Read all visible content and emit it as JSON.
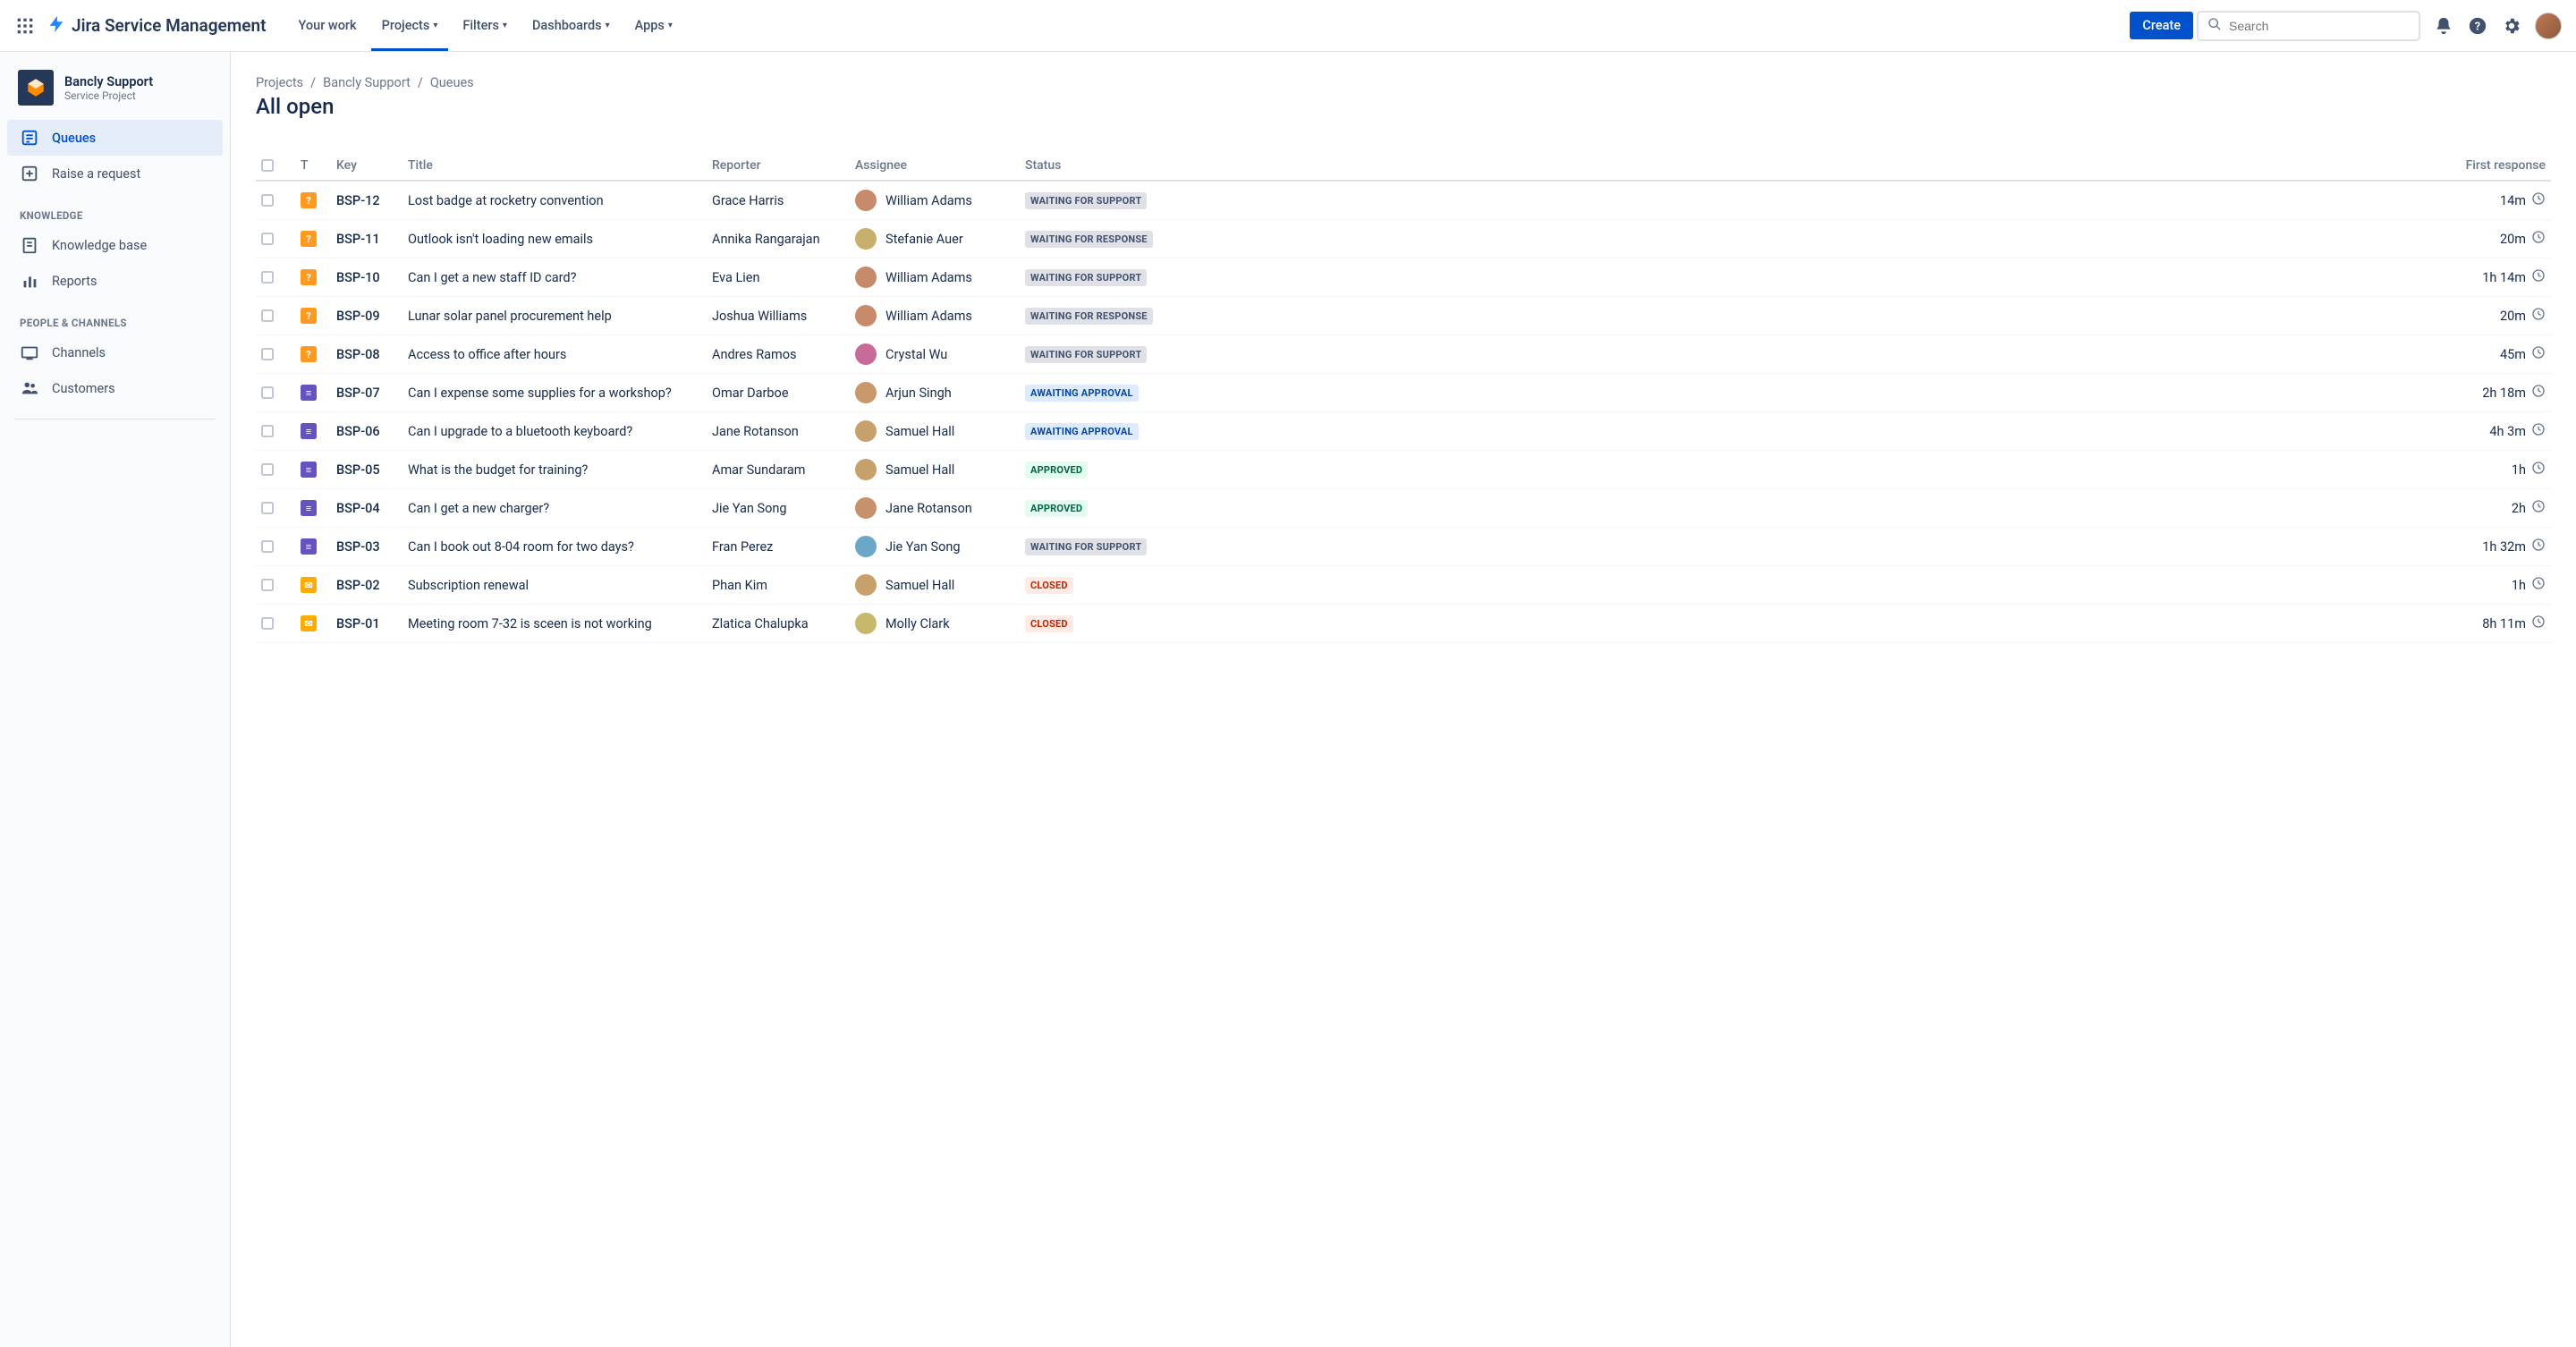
{
  "topnav": {
    "product": "Jira Service Management",
    "items": [
      "Your work",
      "Projects",
      "Filters",
      "Dashboards",
      "Apps"
    ],
    "activeIndex": 1,
    "create": "Create",
    "searchPlaceholder": "Search"
  },
  "sidebar": {
    "project": {
      "name": "Bancly Support",
      "type": "Service Project"
    },
    "primary": [
      {
        "label": "Queues",
        "icon": "queues"
      },
      {
        "label": "Raise a request",
        "icon": "raise"
      }
    ],
    "activePrimary": 0,
    "headings": {
      "knowledge": "KNOWLEDGE",
      "people": "PEOPLE & CHANNELS"
    },
    "knowledge": [
      {
        "label": "Knowledge base",
        "icon": "kb"
      },
      {
        "label": "Reports",
        "icon": "reports"
      }
    ],
    "people": [
      {
        "label": "Channels",
        "icon": "channels"
      },
      {
        "label": "Customers",
        "icon": "customers"
      }
    ]
  },
  "breadcrumb": [
    "Projects",
    "Bancly Support",
    "Queues"
  ],
  "pageTitle": "All open",
  "columns": {
    "t": "T",
    "key": "Key",
    "title": "Title",
    "reporter": "Reporter",
    "assignee": "Assignee",
    "status": "Status",
    "first": "First response"
  },
  "statusLabels": {
    "waitSupport": "WAITING FOR SUPPORT",
    "waitResponse": "WAITING FOR RESPONSE",
    "awaitApproval": "AWAITING APPROVAL",
    "approved": "APPROVED",
    "closed": "CLOSED"
  },
  "tickets": [
    {
      "type": "orange",
      "typeGlyph": "?",
      "key": "BSP-12",
      "title": "Lost badge at rocketry convention",
      "reporter": "Grace Harris",
      "assignee": "William Adams",
      "avatarHue": 20,
      "status": "waitSupport",
      "statusClass": "gray",
      "time": "14m"
    },
    {
      "type": "orange",
      "typeGlyph": "?",
      "key": "BSP-11",
      "title": "Outlook isn't loading new emails",
      "reporter": "Annika Rangarajan",
      "assignee": "Stefanie Auer",
      "avatarHue": 45,
      "status": "waitResponse",
      "statusClass": "gray",
      "time": "20m"
    },
    {
      "type": "orange",
      "typeGlyph": "?",
      "key": "BSP-10",
      "title": "Can I get a new staff ID card?",
      "reporter": "Eva Lien",
      "assignee": "William Adams",
      "avatarHue": 20,
      "status": "waitSupport",
      "statusClass": "gray",
      "time": "1h 14m"
    },
    {
      "type": "orange",
      "typeGlyph": "?",
      "key": "BSP-09",
      "title": "Lunar solar panel procurement help",
      "reporter": "Joshua Williams",
      "assignee": "William Adams",
      "avatarHue": 20,
      "status": "waitResponse",
      "statusClass": "gray",
      "time": "20m"
    },
    {
      "type": "orange",
      "typeGlyph": "?",
      "key": "BSP-08",
      "title": "Access to office after hours",
      "reporter": "Andres Ramos",
      "assignee": "Crystal Wu",
      "avatarHue": 330,
      "status": "waitSupport",
      "statusClass": "gray",
      "time": "45m"
    },
    {
      "type": "purple",
      "typeGlyph": "≡",
      "key": "BSP-07",
      "title": "Can I expense some supplies for a workshop?",
      "reporter": "Omar Darboe",
      "assignee": "Arjun Singh",
      "avatarHue": 30,
      "status": "awaitApproval",
      "statusClass": "blue",
      "time": "2h 18m"
    },
    {
      "type": "purple",
      "typeGlyph": "≡",
      "key": "BSP-06",
      "title": "Can I upgrade to a bluetooth keyboard?",
      "reporter": "Jane Rotanson",
      "assignee": "Samuel Hall",
      "avatarHue": 35,
      "status": "awaitApproval",
      "statusClass": "blue",
      "time": "4h 3m"
    },
    {
      "type": "purple",
      "typeGlyph": "≡",
      "key": "BSP-05",
      "title": "What is the budget for training?",
      "reporter": "Amar Sundaram",
      "assignee": "Samuel Hall",
      "avatarHue": 35,
      "status": "approved",
      "statusClass": "green",
      "time": "1h"
    },
    {
      "type": "purple",
      "typeGlyph": "≡",
      "key": "BSP-04",
      "title": "Can I get a new charger?",
      "reporter": "Jie Yan Song",
      "assignee": "Jane Rotanson",
      "avatarHue": 25,
      "status": "approved",
      "statusClass": "green",
      "time": "2h"
    },
    {
      "type": "purple",
      "typeGlyph": "≡",
      "key": "BSP-03",
      "title": "Can I book out 8-04 room for two days?",
      "reporter": "Fran Perez",
      "assignee": "Jie Yan Song",
      "avatarHue": 200,
      "status": "waitSupport",
      "statusClass": "gray",
      "time": "1h 32m"
    },
    {
      "type": "yellow",
      "typeGlyph": "✉",
      "key": "BSP-02",
      "title": "Subscription renewal",
      "reporter": "Phan Kim",
      "assignee": "Samuel Hall",
      "avatarHue": 35,
      "status": "closed",
      "statusClass": "red",
      "time": "1h"
    },
    {
      "type": "yellow",
      "typeGlyph": "✉",
      "key": "BSP-01",
      "title": "Meeting room 7-32 is sceen is not working",
      "reporter": "Zlatica Chalupka",
      "assignee": "Molly Clark",
      "avatarHue": 50,
      "status": "closed",
      "statusClass": "red",
      "time": "8h 11m"
    }
  ]
}
